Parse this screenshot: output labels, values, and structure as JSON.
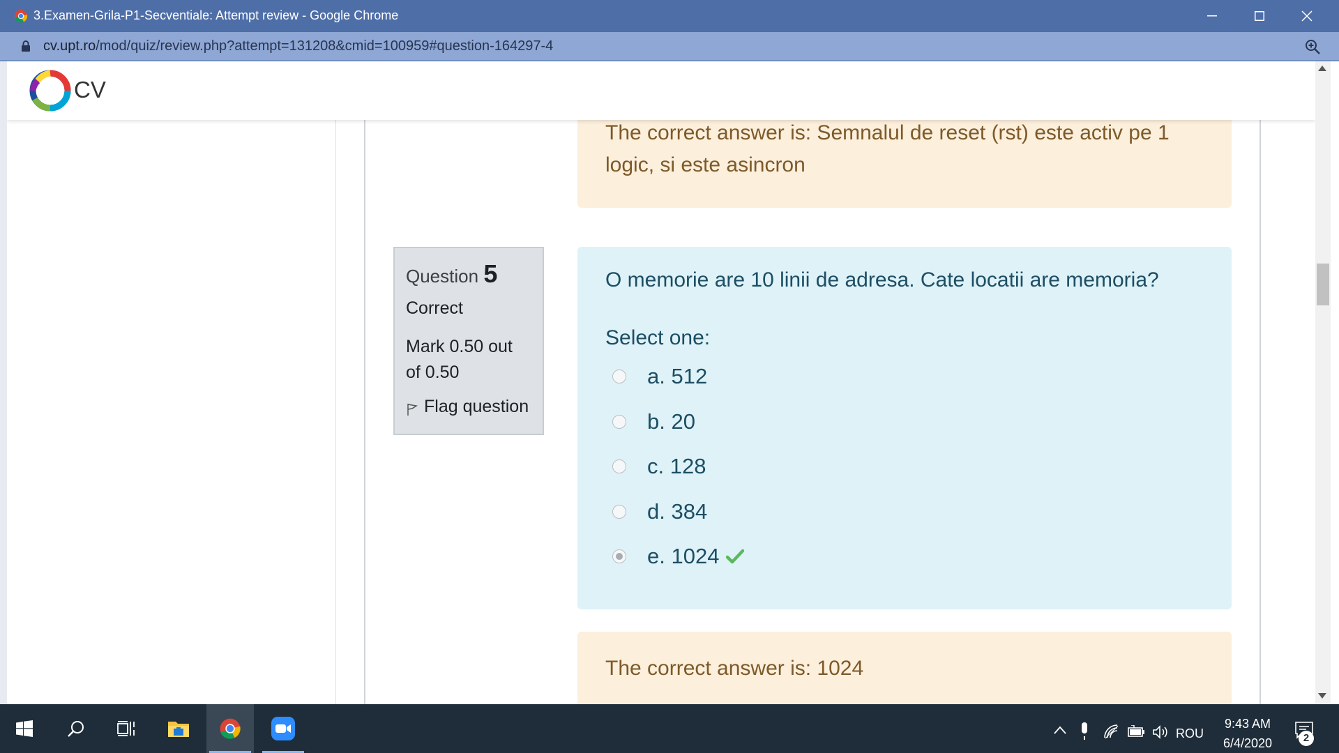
{
  "window": {
    "title": "3.Examen-Grila-P1-Secventiale: Attempt review - Google Chrome",
    "url_host": "cv.upt.ro",
    "url_path": "/mod/quiz/review.php?attempt=131208&cmid=100959#question-164297-4"
  },
  "site": {
    "brand": "CV"
  },
  "previous_question": {
    "feedback": "The correct answer is: Semnalul de reset (rst) este activ pe 1 logic, si este asincron"
  },
  "question": {
    "label": "Question",
    "number": "5",
    "state": "Correct",
    "grade": "Mark 0.50 out of 0.50",
    "flag_label": "Flag question",
    "text": "O memorie are 10 linii de adresa. Cate locatii are memoria?",
    "prompt": "Select one:",
    "answers": [
      {
        "label": "a. 512",
        "selected": false
      },
      {
        "label": "b. 20",
        "selected": false
      },
      {
        "label": "c. 128",
        "selected": false
      },
      {
        "label": "d. 384",
        "selected": false
      },
      {
        "label": "e. 1024",
        "selected": true,
        "correct": true
      }
    ],
    "feedback": "The correct answer is: 1024"
  },
  "taskbar": {
    "apps": [
      "start-icon",
      "search-icon",
      "task-view-icon",
      "file-explorer-icon",
      "chrome-icon",
      "zoom-icon"
    ],
    "language": "ROU",
    "time": "9:43 AM",
    "date": "6/4/2020",
    "notifications": "2"
  },
  "colors": {
    "titlebar": "#4e6ea8",
    "addressbar": "#8fa7d4",
    "question_bg": "#def2f8",
    "feedback_bg": "#fcefdc",
    "correct_check": "#5cb85c",
    "taskbar": "#1f2d3a"
  }
}
